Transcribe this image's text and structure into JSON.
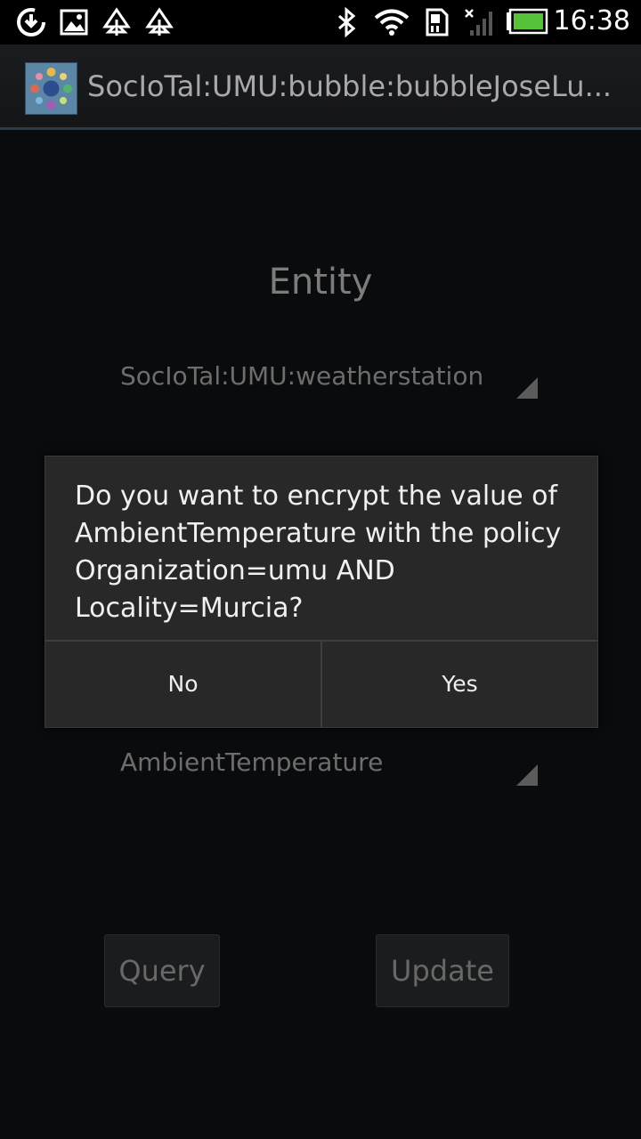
{
  "status_bar": {
    "time": "16:38",
    "icons": [
      "download-icon",
      "image-icon",
      "tree-icon",
      "tree-icon",
      "bluetooth-icon",
      "wifi-icon",
      "sim-icon",
      "signal-icon",
      "battery-icon"
    ],
    "battery_color": "#57c13a"
  },
  "title_bar": {
    "title": "SocIoTal:UMU:bubble:bubbleJoseLu..."
  },
  "content": {
    "entity_heading": "Entity",
    "entity_spinner_value": "SocIoTal:UMU:weatherstation",
    "attribute_spinner_value": "AmbientTemperature",
    "query_button": "Query",
    "update_button": "Update"
  },
  "dialog": {
    "message": "Do you want to encrypt the value of AmbientTemperature with the policy Organization=umu AND Locality=Murcia?",
    "no_button": "No",
    "yes_button": "Yes"
  }
}
